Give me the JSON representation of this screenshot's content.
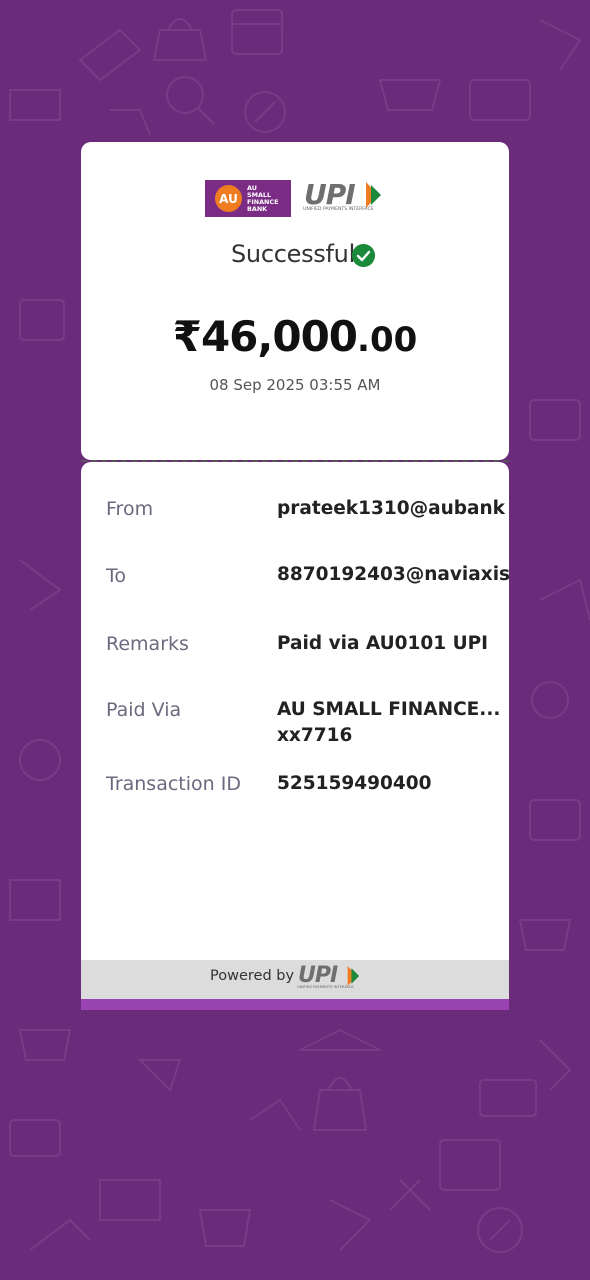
{
  "header": {
    "bank_logo_mark": "AU",
    "bank_logo_text": "AU\nSMALL\nFINANCE\nBANK",
    "upi_logo_text": "UPI",
    "upi_logo_subtext": "UNIFIED PAYMENTS INTERFACE"
  },
  "status": {
    "label": "Successful",
    "icon": "check-circle-icon",
    "color": "#1b8a3a"
  },
  "amount": {
    "main": "₹46,000",
    "decimal": ".00"
  },
  "datetime": "08 Sep 2025 03:55 AM",
  "details": [
    {
      "label": "From",
      "value": "prateek1310@aubank"
    },
    {
      "label": "To",
      "value": "8870192403@naviaxis"
    },
    {
      "label": "Remarks",
      "value": "Paid via AU0101 UPI"
    },
    {
      "label": "Paid Via",
      "value": "AU SMALL FINANCE...",
      "value2": "xx7716"
    },
    {
      "label": "Transaction ID",
      "value": "525159490400"
    }
  ],
  "footer": {
    "powered_by": "Powered by",
    "upi_logo_text": "UPI",
    "upi_logo_subtext": "UNIFIED PAYMENTS INTERFACE"
  },
  "colors": {
    "background": "#6a2c7a",
    "accent": "#9a44b3",
    "bank_brand": "#7b2d86",
    "bank_orange": "#f07c22"
  }
}
